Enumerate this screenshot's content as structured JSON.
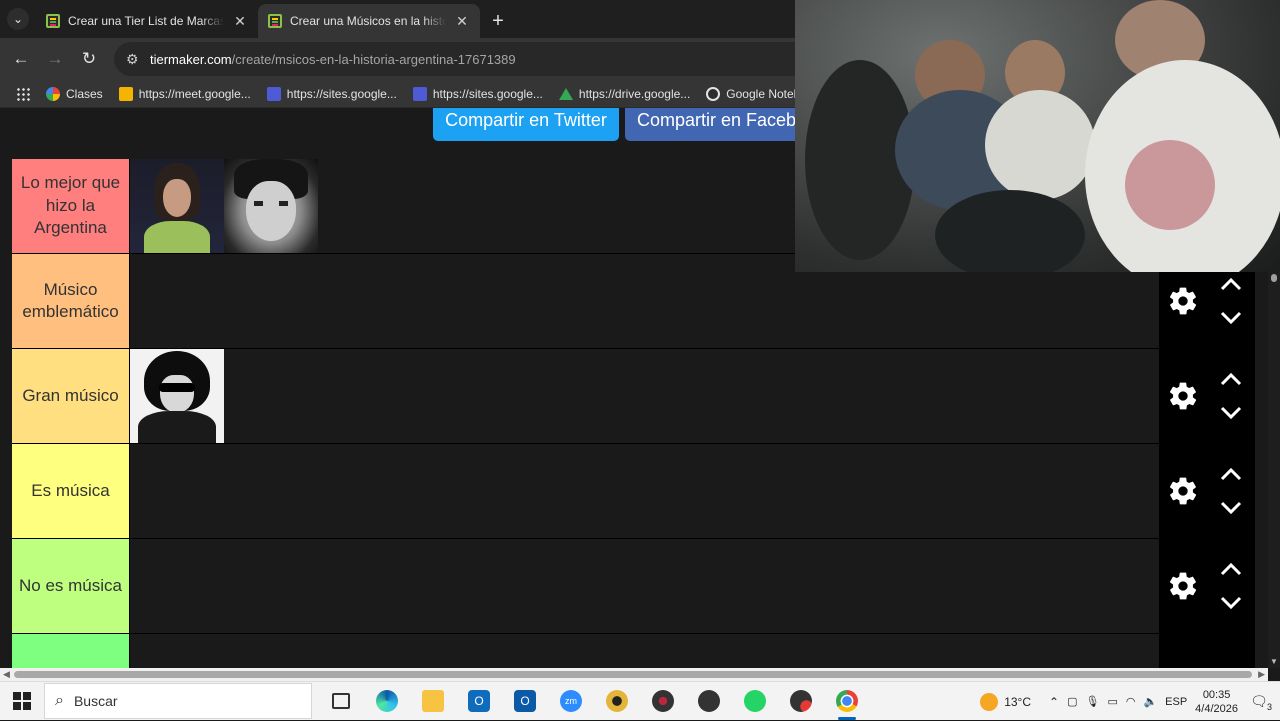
{
  "browser": {
    "tabs": [
      {
        "title": "Crear una Tier List de Marcas de",
        "active": false
      },
      {
        "title": "Crear una Músicos en la historia",
        "active": true
      }
    ],
    "url_host": "tiermaker.com",
    "url_path": "/create/msicos-en-la-historia-argentina-17671389",
    "bookmarks": [
      {
        "label": "Clases",
        "icon": "google-icon"
      },
      {
        "label": "https://meet.google...",
        "icon": "classroom-icon"
      },
      {
        "label": "https://sites.google...",
        "icon": "sites-icon"
      },
      {
        "label": "https://sites.google...",
        "icon": "sites-icon"
      },
      {
        "label": "https://drive.google...",
        "icon": "drive-icon"
      },
      {
        "label": "Google Notebo",
        "icon": "notebooklm-icon"
      }
    ]
  },
  "share": {
    "twitter": "Compartir en Twitter",
    "facebook": "Compartir en Faceb"
  },
  "tiers": [
    {
      "label": "Lo mejor que hizo la Argentina",
      "color": "#ff7f7f",
      "items": [
        "musician-portrait-1",
        "musician-portrait-2"
      ]
    },
    {
      "label": "Músico emblemático",
      "color": "#ffbf7f",
      "items": []
    },
    {
      "label": "Gran músico",
      "color": "#ffdf7f",
      "items": [
        "musician-portrait-3"
      ]
    },
    {
      "label": "Es música",
      "color": "#ffff7f",
      "items": []
    },
    {
      "label": "No es música",
      "color": "#bfff7f",
      "items": []
    },
    {
      "label": "",
      "color": "#7fff7f",
      "items": []
    }
  ],
  "taskbar": {
    "search_placeholder": "Buscar",
    "temperature": "13°C",
    "language": "ESP",
    "time": "00:35",
    "date": "4/4/2026",
    "notification_count": "3"
  }
}
